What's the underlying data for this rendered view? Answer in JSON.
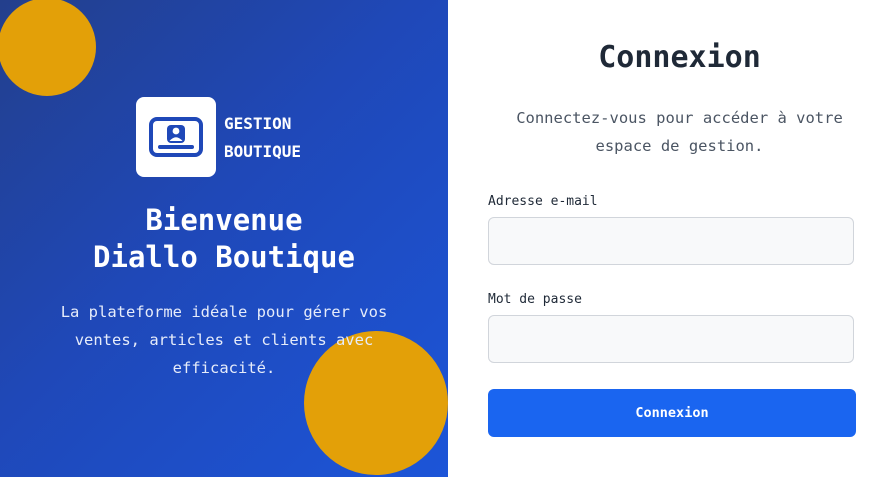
{
  "brand": {
    "line1": "GESTION",
    "line2": "BOUTIQUE",
    "logo_icon": "id-card-icon"
  },
  "hero": {
    "welcome_line1": "Bienvenue",
    "welcome_line2": "Diallo Boutique",
    "tagline": "La plateforme idéale pour gérer vos ventes, articles et clients avec efficacité."
  },
  "login": {
    "title": "Connexion",
    "subtitle": "Connectez-vous pour accéder à votre espace de gestion.",
    "email_label": "Adresse e-mail",
    "email_value": "",
    "password_label": "Mot de passe",
    "password_value": "",
    "submit_label": "Connexion"
  },
  "colors": {
    "primary": "#1a65f0",
    "panel": "#1f48b8",
    "accent": "#e3a008"
  }
}
